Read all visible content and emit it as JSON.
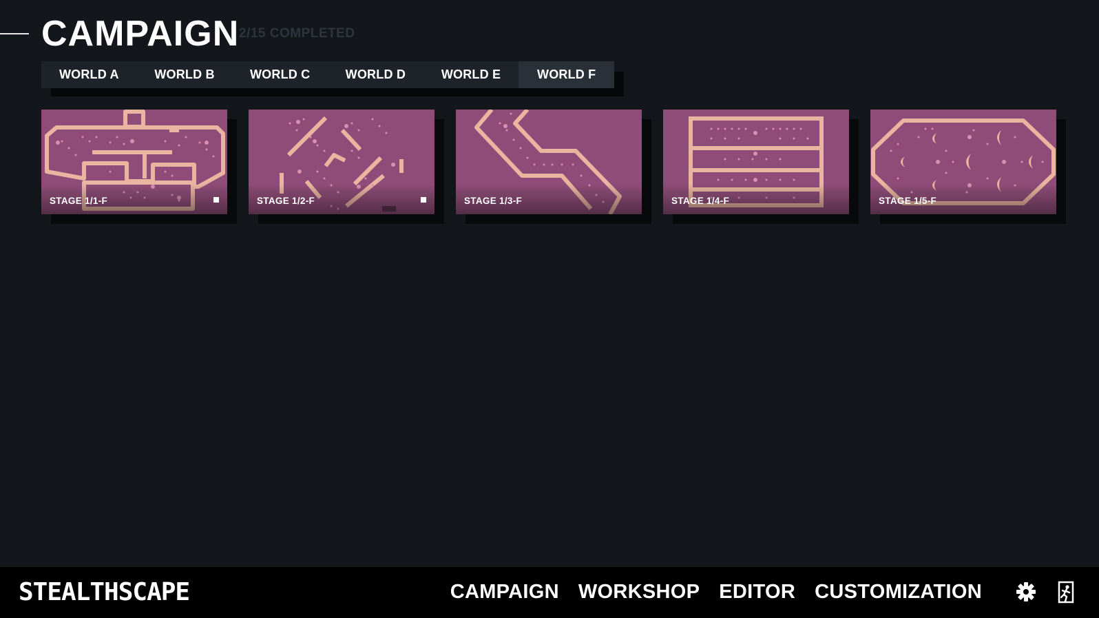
{
  "header": {
    "title": "CAMPAIGN",
    "progress": "2/15 COMPLETED"
  },
  "tabs": [
    {
      "label": "WORLD A",
      "active": false
    },
    {
      "label": "WORLD B",
      "active": false
    },
    {
      "label": "WORLD C",
      "active": false
    },
    {
      "label": "WORLD D",
      "active": false
    },
    {
      "label": "WORLD E",
      "active": false
    },
    {
      "label": "WORLD F",
      "active": true
    }
  ],
  "stages": [
    {
      "label": "STAGE 1/1-F",
      "completed": true
    },
    {
      "label": "STAGE 1/2-F",
      "completed": true
    },
    {
      "label": "STAGE 1/3-F",
      "completed": false
    },
    {
      "label": "STAGE 1/4-F",
      "completed": false
    },
    {
      "label": "STAGE 1/5-F",
      "completed": false
    }
  ],
  "footer": {
    "logo": "STEALTHSCAPE",
    "nav": [
      "CAMPAIGN",
      "WORKSHOP",
      "EDITOR",
      "CUSTOMIZATION"
    ],
    "settings_icon": "gear-icon",
    "exit_icon": "exit-icon"
  },
  "colors": {
    "background": "#13161b",
    "card": "#8f4c78",
    "wall": "#e9b4a0",
    "dot": "#d98fb0",
    "tab_bg": "#1e232a",
    "tab_active": "#2a3038"
  }
}
